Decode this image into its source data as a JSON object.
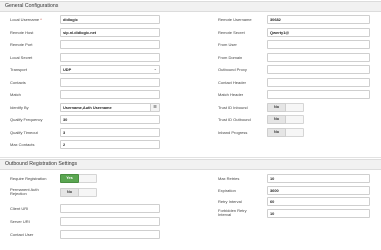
{
  "general": {
    "title": "General Configurations",
    "left": [
      {
        "label": "Local Username",
        "required": "*",
        "value": "didlogic",
        "kind": "text"
      },
      {
        "label": "Remote Host",
        "value": "sip.nl.didlogic.net",
        "kind": "text"
      },
      {
        "label": "Remote Port",
        "value": "",
        "kind": "text"
      },
      {
        "label": "Local Secret",
        "value": "",
        "kind": "text"
      },
      {
        "label": "Transport",
        "value": "UDP",
        "kind": "select"
      },
      {
        "label": "Contacts",
        "value": "",
        "kind": "text"
      },
      {
        "label": "Match",
        "value": "",
        "kind": "text"
      },
      {
        "label": "Identify By",
        "value": "Username,Auth Username",
        "kind": "picker"
      },
      {
        "label": "Qualify Frequency",
        "value": "30",
        "kind": "text"
      },
      {
        "label": "Qualify Timeout",
        "value": "3",
        "kind": "text"
      },
      {
        "label": "Max Contacts",
        "value": "2",
        "kind": "text"
      }
    ],
    "right": [
      {
        "label": "Remote Username",
        "value": "30682",
        "kind": "text"
      },
      {
        "label": "Remote Secret",
        "value": "Qwerty1@",
        "kind": "text"
      },
      {
        "label": "From User",
        "value": "",
        "kind": "text"
      },
      {
        "label": "From Domain",
        "value": "",
        "kind": "text"
      },
      {
        "label": "Outbound Proxy",
        "value": "",
        "kind": "text"
      },
      {
        "label": "Contact Header",
        "value": "",
        "kind": "text"
      },
      {
        "label": "Match Header",
        "value": "",
        "kind": "text"
      },
      {
        "label": "Trust ID Inbound",
        "value": "No",
        "kind": "toggle"
      },
      {
        "label": "Trust ID Outbound",
        "value": "No",
        "kind": "toggle"
      },
      {
        "label": "Inband Progress",
        "value": "No",
        "kind": "toggle"
      }
    ]
  },
  "outbound": {
    "title": "Outbound Registration Settings",
    "left": [
      {
        "label": "Require Registration",
        "value": "Yes",
        "kind": "toggle-yes"
      },
      {
        "label": "Permanent Auth",
        "label2": "Rejection",
        "value": "No",
        "kind": "toggle"
      },
      {
        "label": "Client URI",
        "value": "",
        "kind": "text"
      },
      {
        "label": "Server URI",
        "value": "",
        "kind": "text"
      },
      {
        "label": "Contact User",
        "value": "",
        "kind": "text"
      }
    ],
    "right": [
      {
        "label": "Max Retries",
        "value": "10",
        "kind": "text"
      },
      {
        "label": "Expiration",
        "value": "3600",
        "kind": "text"
      },
      {
        "label": "Retry Interval",
        "value": "60",
        "kind": "text"
      },
      {
        "label": "Forbidden Retry",
        "label2": "Interval",
        "value": "10",
        "kind": "text"
      }
    ]
  },
  "icons": {
    "picker": "list-icon",
    "select": "chevron-down-icon"
  }
}
